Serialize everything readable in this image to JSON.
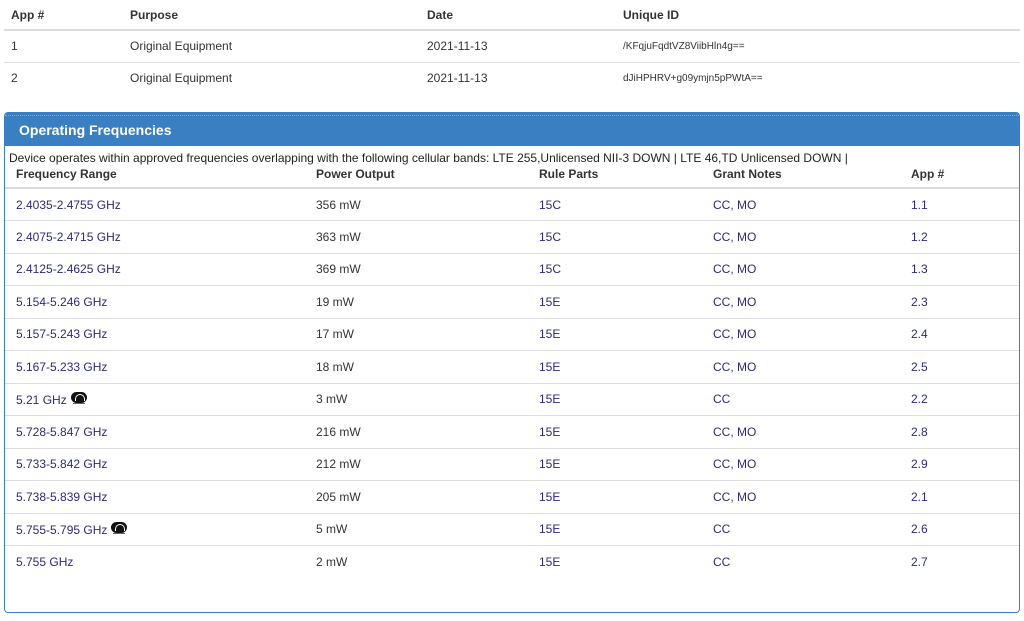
{
  "apps": {
    "headers": {
      "app": "App #",
      "purpose": "Purpose",
      "date": "Date",
      "uid": "Unique ID"
    },
    "rows": [
      {
        "app": "1",
        "purpose": "Original Equipment",
        "date": "2021-11-13",
        "uid": "/KFqjuFqdtVZ8ViibHln4g=="
      },
      {
        "app": "2",
        "purpose": "Original Equipment",
        "date": "2021-11-13",
        "uid": "dJiHPHRV+g09ymjn5pPWtA=="
      }
    ]
  },
  "panel": {
    "title": "Operating Frequencies",
    "description": "Device operates within approved frequencies overlapping with the following cellular bands: LTE 255,Unlicensed NII-3 DOWN | LTE 46,TD Unlicensed DOWN |",
    "headers": {
      "range": "Frequency Range",
      "power": "Power Output",
      "rule": "Rule Parts",
      "notes": "Grant Notes",
      "app": "App #"
    },
    "rows": [
      {
        "range": "2.4035-2.4755 GHz",
        "power": "356 mW",
        "rule": "15C",
        "notes": "CC, MO",
        "app": "1.1",
        "wifi": false
      },
      {
        "range": "2.4075-2.4715 GHz",
        "power": "363 mW",
        "rule": "15C",
        "notes": "CC, MO",
        "app": "1.2",
        "wifi": false
      },
      {
        "range": "2.4125-2.4625 GHz",
        "power": "369 mW",
        "rule": "15C",
        "notes": "CC, MO",
        "app": "1.3",
        "wifi": false
      },
      {
        "range": "5.154-5.246 GHz",
        "power": "19 mW",
        "rule": "15E",
        "notes": "CC, MO",
        "app": "2.3",
        "wifi": false
      },
      {
        "range": "5.157-5.243 GHz",
        "power": "17 mW",
        "rule": "15E",
        "notes": "CC, MO",
        "app": "2.4",
        "wifi": false
      },
      {
        "range": "5.167-5.233 GHz",
        "power": "18 mW",
        "rule": "15E",
        "notes": "CC, MO",
        "app": "2.5",
        "wifi": false
      },
      {
        "range": "5.21 GHz",
        "power": "3 mW",
        "rule": "15E",
        "notes": "CC",
        "app": "2.2",
        "wifi": true
      },
      {
        "range": "5.728-5.847 GHz",
        "power": "216 mW",
        "rule": "15E",
        "notes": "CC, MO",
        "app": "2.8",
        "wifi": false
      },
      {
        "range": "5.733-5.842 GHz",
        "power": "212 mW",
        "rule": "15E",
        "notes": "CC, MO",
        "app": "2.9",
        "wifi": false
      },
      {
        "range": "5.738-5.839 GHz",
        "power": "205 mW",
        "rule": "15E",
        "notes": "CC, MO",
        "app": "2.1",
        "wifi": false
      },
      {
        "range": "5.755-5.795 GHz",
        "power": "5 mW",
        "rule": "15E",
        "notes": "CC",
        "app": "2.6",
        "wifi": true
      },
      {
        "range": "5.755 GHz",
        "power": "2 mW",
        "rule": "15E",
        "notes": "CC",
        "app": "2.7",
        "wifi": false
      }
    ]
  },
  "icons": {
    "wifi": "wifi-badge-icon"
  },
  "colors": {
    "panel_header": "#3a7fc1",
    "link": "#2a2a7f"
  }
}
